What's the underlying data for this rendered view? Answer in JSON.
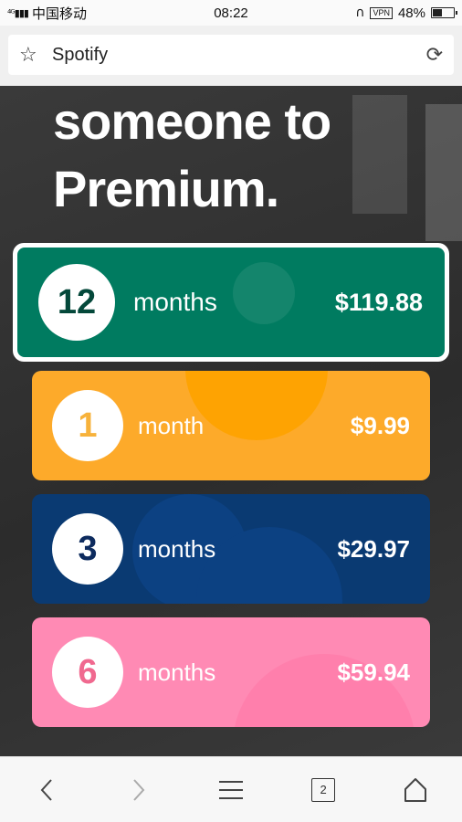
{
  "status_bar": {
    "signal": "4G 4G",
    "carrier": "中国移动",
    "time": "08:22",
    "vpn": "VPN",
    "battery": "48%",
    "battery_level": 0.48
  },
  "browser": {
    "url_text": "Spotify",
    "tab_count": "2"
  },
  "page": {
    "heading_line1": "someone to",
    "heading_line2": "Premium."
  },
  "plans": [
    {
      "count": "12",
      "unit": "months",
      "price": "$119.88",
      "color": "#007b60",
      "selected": true
    },
    {
      "count": "1",
      "unit": "month",
      "price": "$9.99",
      "color": "#fdaa2a"
    },
    {
      "count": "3",
      "unit": "months",
      "price": "$29.97",
      "color": "#0a3a72"
    },
    {
      "count": "6",
      "unit": "months",
      "price": "$59.94",
      "color": "#ff8ab4"
    }
  ],
  "nav_icons": [
    "back-icon",
    "forward-icon",
    "menu-icon",
    "tabs-icon",
    "home-icon"
  ]
}
